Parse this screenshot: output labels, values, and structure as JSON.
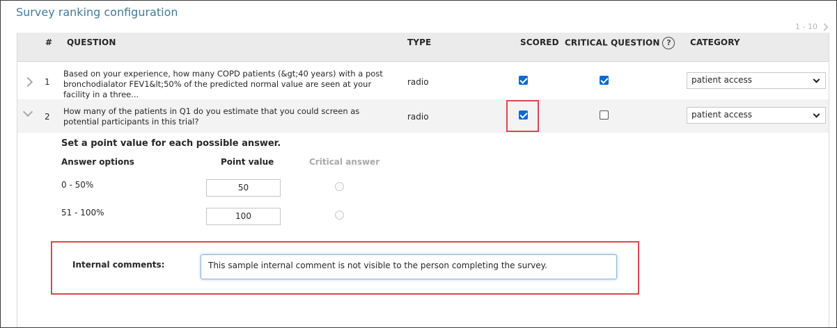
{
  "page": {
    "title": "Survey ranking configuration"
  },
  "pager": {
    "range": "1 - 10"
  },
  "table": {
    "headers": {
      "num": "#",
      "question": "QUESTION",
      "type": "TYPE",
      "scored": "SCORED",
      "critical": "CRITICAL QUESTION",
      "category": "CATEGORY"
    },
    "help_glyph": "?",
    "rows": [
      {
        "num": "1",
        "question": "Based on your experience, how many COPD patients (&gt;40 years) with a post bronchodialator FEV1&lt;50% of the predicted normal value are seen at your facility in a three...",
        "type": "radio",
        "scored": true,
        "critical": true,
        "category": "patient access",
        "expanded": false
      },
      {
        "num": "2",
        "question": "How many of the patients in Q1 do you estimate that you could screen as potential participants in this trial?",
        "type": "radio",
        "scored": true,
        "critical": false,
        "category": "patient access",
        "expanded": true
      }
    ]
  },
  "details": {
    "heading": "Set a point value for each possible answer.",
    "columns": {
      "options": "Answer options",
      "points": "Point value",
      "critical": "Critical answer"
    },
    "answers": [
      {
        "label": "0 - 50%",
        "points": "50",
        "critical": false
      },
      {
        "label": "51 - 100%",
        "points": "100",
        "critical": false
      }
    ],
    "comment_label": "Internal comments:",
    "comment_value": "This sample internal comment is not visible to the person completing the survey."
  },
  "icons": {
    "expand_collapsed": "chevron-right-icon",
    "expand_expanded": "chevron-down-icon",
    "pager_next": "chevron-right-icon",
    "help": "help-icon",
    "select_arrow": "chevron-down-icon"
  },
  "colors": {
    "title": "#3f7c9c",
    "checkbox": "#0b6bd3",
    "highlight": "#e0444b",
    "header_bg": "#ebebeb"
  }
}
